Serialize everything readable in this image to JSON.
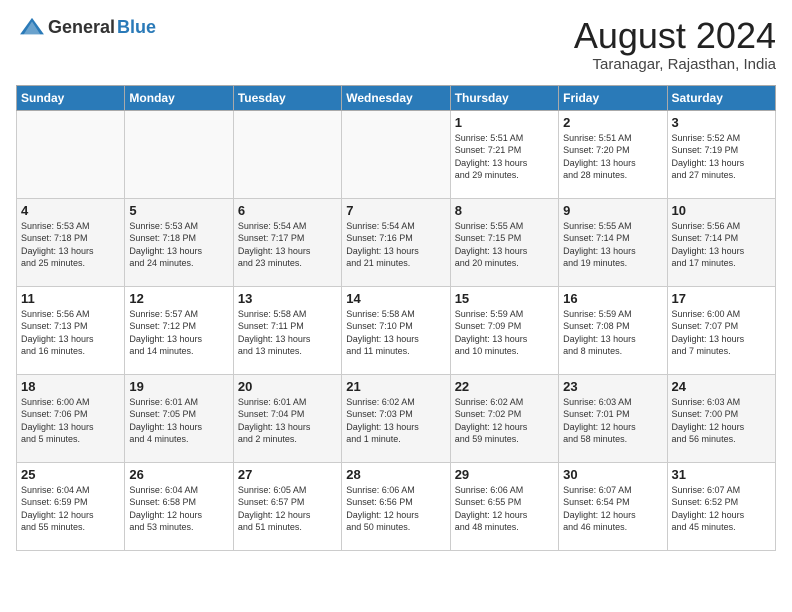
{
  "header": {
    "logo_general": "General",
    "logo_blue": "Blue",
    "month_year": "August 2024",
    "location": "Taranagar, Rajasthan, India"
  },
  "days_of_week": [
    "Sunday",
    "Monday",
    "Tuesday",
    "Wednesday",
    "Thursday",
    "Friday",
    "Saturday"
  ],
  "weeks": [
    [
      {
        "day": "",
        "text": ""
      },
      {
        "day": "",
        "text": ""
      },
      {
        "day": "",
        "text": ""
      },
      {
        "day": "",
        "text": ""
      },
      {
        "day": "1",
        "text": "Sunrise: 5:51 AM\nSunset: 7:21 PM\nDaylight: 13 hours\nand 29 minutes."
      },
      {
        "day": "2",
        "text": "Sunrise: 5:51 AM\nSunset: 7:20 PM\nDaylight: 13 hours\nand 28 minutes."
      },
      {
        "day": "3",
        "text": "Sunrise: 5:52 AM\nSunset: 7:19 PM\nDaylight: 13 hours\nand 27 minutes."
      }
    ],
    [
      {
        "day": "4",
        "text": "Sunrise: 5:53 AM\nSunset: 7:18 PM\nDaylight: 13 hours\nand 25 minutes."
      },
      {
        "day": "5",
        "text": "Sunrise: 5:53 AM\nSunset: 7:18 PM\nDaylight: 13 hours\nand 24 minutes."
      },
      {
        "day": "6",
        "text": "Sunrise: 5:54 AM\nSunset: 7:17 PM\nDaylight: 13 hours\nand 23 minutes."
      },
      {
        "day": "7",
        "text": "Sunrise: 5:54 AM\nSunset: 7:16 PM\nDaylight: 13 hours\nand 21 minutes."
      },
      {
        "day": "8",
        "text": "Sunrise: 5:55 AM\nSunset: 7:15 PM\nDaylight: 13 hours\nand 20 minutes."
      },
      {
        "day": "9",
        "text": "Sunrise: 5:55 AM\nSunset: 7:14 PM\nDaylight: 13 hours\nand 19 minutes."
      },
      {
        "day": "10",
        "text": "Sunrise: 5:56 AM\nSunset: 7:14 PM\nDaylight: 13 hours\nand 17 minutes."
      }
    ],
    [
      {
        "day": "11",
        "text": "Sunrise: 5:56 AM\nSunset: 7:13 PM\nDaylight: 13 hours\nand 16 minutes."
      },
      {
        "day": "12",
        "text": "Sunrise: 5:57 AM\nSunset: 7:12 PM\nDaylight: 13 hours\nand 14 minutes."
      },
      {
        "day": "13",
        "text": "Sunrise: 5:58 AM\nSunset: 7:11 PM\nDaylight: 13 hours\nand 13 minutes."
      },
      {
        "day": "14",
        "text": "Sunrise: 5:58 AM\nSunset: 7:10 PM\nDaylight: 13 hours\nand 11 minutes."
      },
      {
        "day": "15",
        "text": "Sunrise: 5:59 AM\nSunset: 7:09 PM\nDaylight: 13 hours\nand 10 minutes."
      },
      {
        "day": "16",
        "text": "Sunrise: 5:59 AM\nSunset: 7:08 PM\nDaylight: 13 hours\nand 8 minutes."
      },
      {
        "day": "17",
        "text": "Sunrise: 6:00 AM\nSunset: 7:07 PM\nDaylight: 13 hours\nand 7 minutes."
      }
    ],
    [
      {
        "day": "18",
        "text": "Sunrise: 6:00 AM\nSunset: 7:06 PM\nDaylight: 13 hours\nand 5 minutes."
      },
      {
        "day": "19",
        "text": "Sunrise: 6:01 AM\nSunset: 7:05 PM\nDaylight: 13 hours\nand 4 minutes."
      },
      {
        "day": "20",
        "text": "Sunrise: 6:01 AM\nSunset: 7:04 PM\nDaylight: 13 hours\nand 2 minutes."
      },
      {
        "day": "21",
        "text": "Sunrise: 6:02 AM\nSunset: 7:03 PM\nDaylight: 13 hours\nand 1 minute."
      },
      {
        "day": "22",
        "text": "Sunrise: 6:02 AM\nSunset: 7:02 PM\nDaylight: 12 hours\nand 59 minutes."
      },
      {
        "day": "23",
        "text": "Sunrise: 6:03 AM\nSunset: 7:01 PM\nDaylight: 12 hours\nand 58 minutes."
      },
      {
        "day": "24",
        "text": "Sunrise: 6:03 AM\nSunset: 7:00 PM\nDaylight: 12 hours\nand 56 minutes."
      }
    ],
    [
      {
        "day": "25",
        "text": "Sunrise: 6:04 AM\nSunset: 6:59 PM\nDaylight: 12 hours\nand 55 minutes."
      },
      {
        "day": "26",
        "text": "Sunrise: 6:04 AM\nSunset: 6:58 PM\nDaylight: 12 hours\nand 53 minutes."
      },
      {
        "day": "27",
        "text": "Sunrise: 6:05 AM\nSunset: 6:57 PM\nDaylight: 12 hours\nand 51 minutes."
      },
      {
        "day": "28",
        "text": "Sunrise: 6:06 AM\nSunset: 6:56 PM\nDaylight: 12 hours\nand 50 minutes."
      },
      {
        "day": "29",
        "text": "Sunrise: 6:06 AM\nSunset: 6:55 PM\nDaylight: 12 hours\nand 48 minutes."
      },
      {
        "day": "30",
        "text": "Sunrise: 6:07 AM\nSunset: 6:54 PM\nDaylight: 12 hours\nand 46 minutes."
      },
      {
        "day": "31",
        "text": "Sunrise: 6:07 AM\nSunset: 6:52 PM\nDaylight: 12 hours\nand 45 minutes."
      }
    ]
  ]
}
